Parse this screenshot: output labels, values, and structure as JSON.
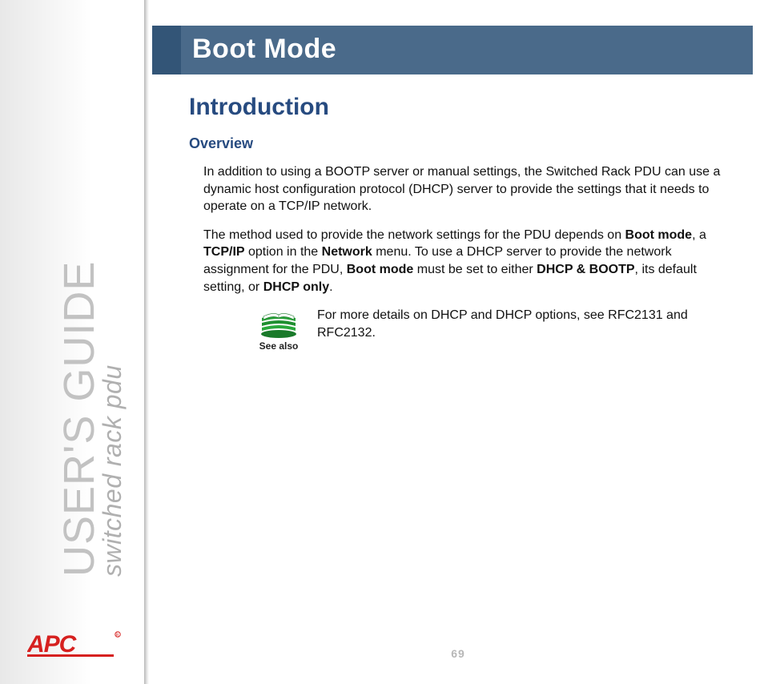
{
  "sidebar": {
    "title": "USER'S GUIDE",
    "subtitle": "switched rack pdu"
  },
  "logo": {
    "text": "APC"
  },
  "header": {
    "title": "Boot Mode"
  },
  "content": {
    "section_heading": "Introduction",
    "sub_heading": "Overview",
    "para1": "In addition to using a BOOTP server or manual settings, the Switched Rack PDU can use a dynamic host configuration protocol (DHCP) server to provide the settings that it needs to operate on a TCP/IP network.",
    "para2_a": "The method used to provide the network settings for the PDU depends on ",
    "para2_b1": "Boot mode",
    "para2_c": ", a ",
    "para2_b2": "TCP/IP",
    "para2_d": " option in the ",
    "para2_b3": "Network",
    "para2_e": " menu. To use a DHCP server to provide the network assignment for the PDU, ",
    "para2_b4": "Boot mode",
    "para2_f": " must be set to either ",
    "para2_b5": "DHCP & BOOTP",
    "para2_g": ", its default setting, or ",
    "para2_b6": "DHCP only",
    "para2_h": "."
  },
  "seealso": {
    "label": "See also",
    "text": "For more details on DHCP and DHCP options, see RFC2131 and RFC2132."
  },
  "footer": {
    "page_number": "69"
  }
}
